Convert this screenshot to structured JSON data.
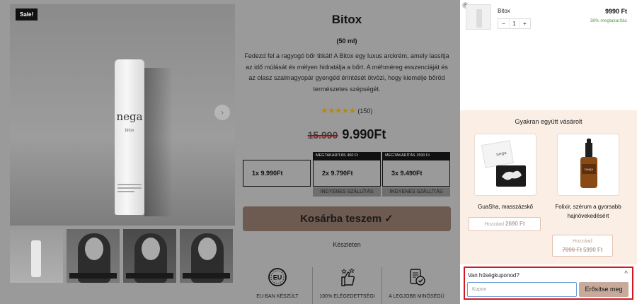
{
  "product": {
    "sale_badge": "Sale!",
    "title": "Bitox",
    "volume": "(50 ml)",
    "description": "Fedezd fel a ragyogó bőr titkát! A Bitox egy luxus arckrém, amely lassítja az idő múlását és mélyen hidratálja a bőrt. A méhméreg esszenciáját és az olasz szalmagyopár gyengéd érintését ötvözi, hogy kiemelje bőröd természetes szépségét.",
    "rating_stars": "★★★★★",
    "rating_count": "(150)",
    "old_price": "15.990",
    "new_price": "9.990Ft",
    "bottle_brand": "nega",
    "bottle_sub": "bitox",
    "next_arrow": "›",
    "offers": [
      {
        "label": "1x 9.990Ft",
        "tag": "",
        "shipping": ""
      },
      {
        "label": "2x 9.790Ft",
        "tag": "MEGTAKARÍTÁS 400 Ft",
        "shipping": "INGYENES SZÁLLÍTÁS"
      },
      {
        "label": "3x 9.490Ft",
        "tag": "MEGTAKARÍTÁS 1500 Ft",
        "shipping": "INGYENES SZÁLLÍTÁS"
      }
    ],
    "add_to_cart": "Kosárba teszem ✓",
    "stock": "Készleten",
    "badges": [
      {
        "icon": "eu-badge-icon",
        "label": "EU-BAN KÉSZÜLT"
      },
      {
        "icon": "thumbs-up-icon",
        "label": "100% ELÉGEDETTSÉGI"
      },
      {
        "icon": "quality-badge-icon",
        "label": "A LEGJOBB MINŐSÉGŰ"
      }
    ]
  },
  "cart": {
    "remove_icon": "×",
    "item": {
      "name": "Bitox",
      "price": "9990 Ft",
      "saving": "38% megtakarítás",
      "qty": "1",
      "minus": "−",
      "plus": "+"
    },
    "fbt": {
      "title": "Gyakran együtt vásárolt",
      "products": [
        {
          "name": "GuaSha, masszázskő",
          "button_label": "Hozzáad",
          "price": "2690 Ft",
          "old_price": ""
        },
        {
          "name": "Folixir, szérum a gyorsabb hajnövekedésért",
          "button_label": "Hozzáad",
          "price": "5990 Ft",
          "old_price": "7990 Ft"
        }
      ]
    },
    "coupon": {
      "title": "Van hűségkuponod?",
      "chevron": "^",
      "placeholder": "Kupon",
      "button": "Erősítse meg"
    }
  }
}
